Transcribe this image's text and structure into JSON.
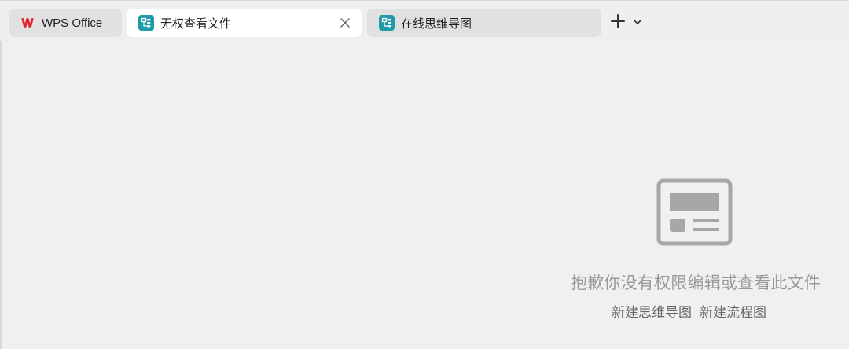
{
  "tabs": [
    {
      "label": "WPS Office",
      "icon": "wps-logo-icon"
    },
    {
      "label": "无权查看文件",
      "icon": "mind-map-icon",
      "active": true
    },
    {
      "label": "在线思维导图",
      "icon": "mind-map-icon"
    }
  ],
  "empty_state": {
    "icon": "document-placeholder-icon",
    "message": "抱歉你没有权限编辑或查看此文件",
    "actions": [
      "新建思维导图",
      "新建流程图"
    ]
  },
  "colors": {
    "background": "#f0f0f0",
    "tab_active": "#ffffff",
    "tab_inactive": "#e1e1e1",
    "wps_red": "#e2242f",
    "mind_teal": "#1f9aa8",
    "message_gray": "#9a9a9a",
    "action_gray": "#666666"
  }
}
